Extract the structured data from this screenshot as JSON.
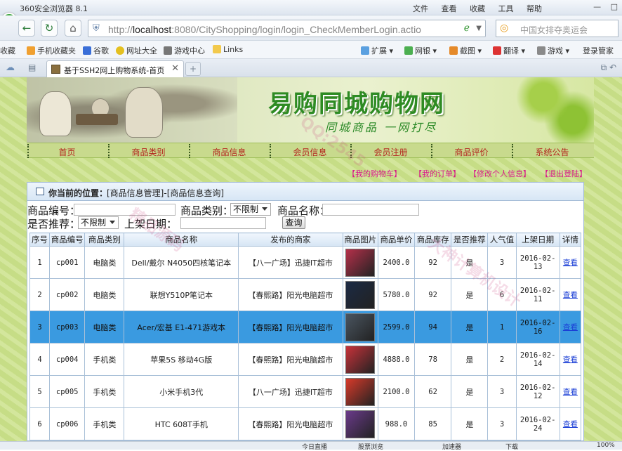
{
  "browser": {
    "title": "360安全浏览器 8.1",
    "menus": [
      "文件",
      "查看",
      "收藏",
      "工具",
      "帮助"
    ],
    "address": {
      "host": "localhost",
      "port_path": ":8080/CityShopping/login/login_CheckMemberLogin.actio",
      "scheme": "http://"
    },
    "search_placeholder": "中国女排夺奥运会",
    "bookmarks": [
      "收藏",
      "手机收藏夹",
      "谷歌",
      "网址大全",
      "游戏中心",
      "Links",
      "扩展",
      "网银",
      "截图",
      "翻译",
      "游戏",
      "登录管家"
    ],
    "tab_title": "基于SSH2网上购物系统-首页"
  },
  "site": {
    "title": "易购同城购物网",
    "subtitle": "同城商品 一网打尽",
    "nav": [
      "首页",
      "商品类别",
      "商品信息",
      "会员信息",
      "会员注册",
      "商品评价",
      "系统公告"
    ],
    "user_menu": [
      "【我的购物车】",
      "【我的订单】",
      "【修改个人信息】",
      "【退出登陆】"
    ]
  },
  "panel": {
    "location_label": "你当前的位置：",
    "location_path": "[商品信息管理]-[商品信息查询]"
  },
  "filters": {
    "code_label": "商品编号：",
    "category_label": "商品类别：",
    "category_value": "不限制",
    "name_label": "商品名称：",
    "recommend_label": "是否推荐：",
    "recommend_value": "不限制",
    "date_label": "上架日期：",
    "query_button": "查询"
  },
  "table": {
    "headers": [
      "序号",
      "商品编号",
      "商品类别",
      "商品名称",
      "发布的商家",
      "商品图片",
      "商品单价",
      "商品库存",
      "是否推荐",
      "人气值",
      "上架日期",
      "详情"
    ],
    "rows": [
      {
        "no": "1",
        "code": "cp001",
        "category": "电脑类",
        "name": "Dell/戴尔 N4050四核笔记本",
        "shop": "【八一广场】迅捷IT超市",
        "price": "2400.0",
        "stock": "92",
        "recommend": "是",
        "hits": "3",
        "date": "2016-02-13",
        "detail": "查看",
        "thumb_color": "#b5304a"
      },
      {
        "no": "2",
        "code": "cp002",
        "category": "电脑类",
        "name": "联想Y510P笔记本",
        "shop": "【春熙路】阳光电脑超市",
        "price": "5780.0",
        "stock": "92",
        "recommend": "是",
        "hits": "6",
        "date": "2016-02-11",
        "detail": "查看",
        "thumb_color": "#1b2a44"
      },
      {
        "no": "3",
        "code": "cp003",
        "category": "电脑类",
        "name": "Acer/宏基 E1-471游戏本",
        "shop": "【春熙路】阳光电脑超市",
        "price": "2599.0",
        "stock": "94",
        "recommend": "是",
        "hits": "1",
        "date": "2016-02-16",
        "detail": "查看",
        "thumb_color": "#4a5560"
      },
      {
        "no": "4",
        "code": "cp004",
        "category": "手机类",
        "name": "苹果5S 移动4G版",
        "shop": "【春熙路】阳光电脑超市",
        "price": "4888.0",
        "stock": "78",
        "recommend": "是",
        "hits": "2",
        "date": "2016-02-14",
        "detail": "查看",
        "thumb_color": "#c8323a"
      },
      {
        "no": "5",
        "code": "cp005",
        "category": "手机类",
        "name": "小米手机3代",
        "shop": "【八一广场】迅捷IT超市",
        "price": "2100.0",
        "stock": "62",
        "recommend": "是",
        "hits": "3",
        "date": "2016-02-12",
        "detail": "查看",
        "thumb_color": "#d83a2a"
      },
      {
        "no": "6",
        "code": "cp006",
        "category": "手机类",
        "name": "HTC 608T手机",
        "shop": "【春熙路】阳光电脑超市",
        "price": "988.0",
        "stock": "85",
        "recommend": "是",
        "hits": "3",
        "date": "2016-02-24",
        "detail": "查看",
        "thumb_color": "#6a3a8a"
      }
    ],
    "selected_row_index": 2
  },
  "statusbar": [
    "今日直播",
    "股票浏览",
    "加速器",
    "下载",
    "100%"
  ],
  "colors": {
    "selected_row": "#3a9ae0",
    "nav_text": "#b3261e",
    "user_menu": "#d8198a",
    "page_bg": "#cde28e"
  }
}
